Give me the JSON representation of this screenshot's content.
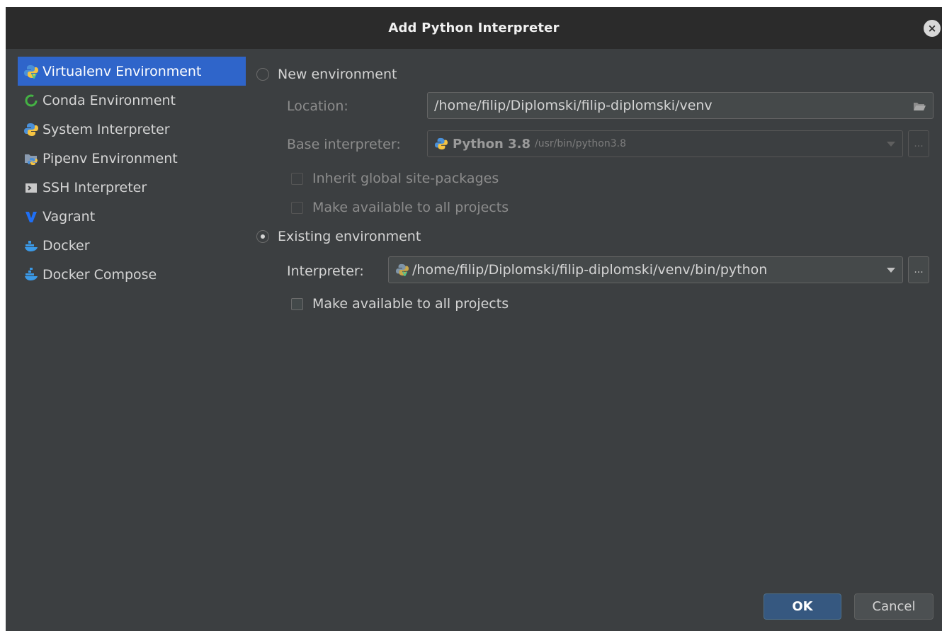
{
  "dialog": {
    "title": "Add Python Interpreter",
    "close_label": "×"
  },
  "sidebar": {
    "items": [
      {
        "label": "Virtualenv Environment",
        "icon": "virtualenv-icon",
        "selected": true
      },
      {
        "label": "Conda Environment",
        "icon": "conda-icon",
        "selected": false
      },
      {
        "label": "System Interpreter",
        "icon": "python-icon",
        "selected": false
      },
      {
        "label": "Pipenv Environment",
        "icon": "pipenv-icon",
        "selected": false
      },
      {
        "label": "SSH Interpreter",
        "icon": "ssh-icon",
        "selected": false
      },
      {
        "label": "Vagrant",
        "icon": "vagrant-icon",
        "selected": false
      },
      {
        "label": "Docker",
        "icon": "docker-icon",
        "selected": false
      },
      {
        "label": "Docker Compose",
        "icon": "docker-compose-icon",
        "selected": false
      }
    ]
  },
  "new_env": {
    "radio_label": "New environment",
    "location_label": "Location:",
    "location_value": "/home/filip/Diplomski/filip-diplomski/venv",
    "base_label": "Base interpreter:",
    "base_name": "Python 3.8",
    "base_path": "/usr/bin/python3.8",
    "inherit_label": "Inherit global site-packages",
    "available_label": "Make available to all projects",
    "ellipsis": "..."
  },
  "existing_env": {
    "radio_label": "Existing environment",
    "interpreter_label": "Interpreter:",
    "interpreter_value": "/home/filip/Diplomski/filip-diplomski/venv/bin/python",
    "available_label": "Make available to all projects",
    "ellipsis": "..."
  },
  "footer": {
    "ok_label": "OK",
    "cancel_label": "Cancel"
  },
  "colors": {
    "accent": "#2f65ca",
    "background": "#3c3f41",
    "titlebar": "#2b2b2b"
  }
}
